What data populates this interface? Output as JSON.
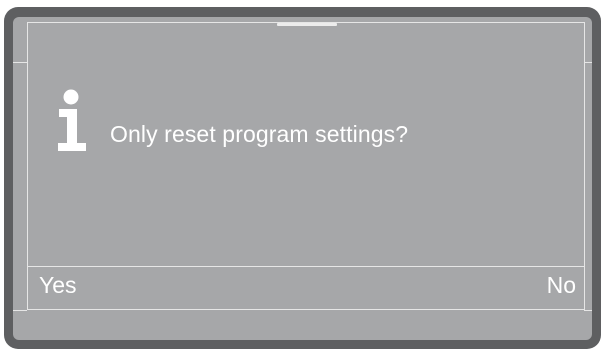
{
  "dialog": {
    "icon": "info-icon",
    "message": "Only reset program settings?",
    "softkeys": {
      "left_label": "Yes",
      "right_label": "No"
    }
  },
  "colors": {
    "bezel": "#5e5f61",
    "screen": "#a6a7a9",
    "text": "#ffffff",
    "lines": "#e6e6e6"
  }
}
